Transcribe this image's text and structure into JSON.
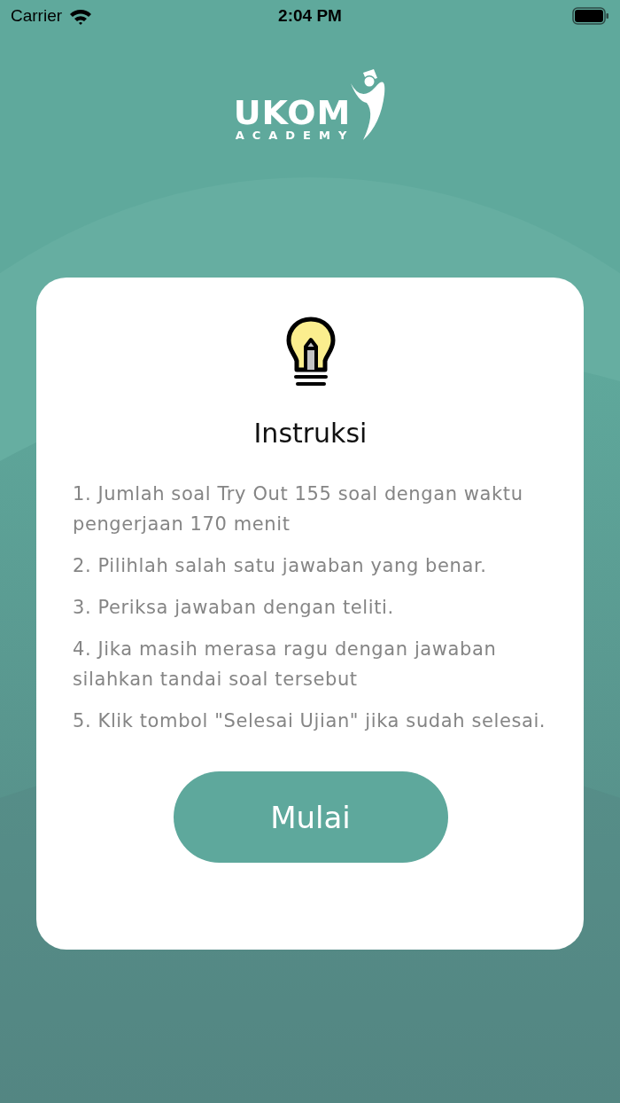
{
  "status_bar": {
    "carrier": "Carrier",
    "time": "2:04 PM"
  },
  "logo": {
    "title": "UKOM",
    "subtitle": "ACADEMY"
  },
  "card": {
    "title": "Instruksi",
    "instructions": [
      "1. Jumlah soal Try Out 155 soal dengan waktu pengerjaan 170 menit",
      "2. Pilihlah salah satu jawaban yang benar.",
      "3. Periksa jawaban dengan teliti.",
      "4. Jika masih merasa ragu dengan jawaban silahkan tandai soal tersebut",
      "5. Klik tombol \"Selesai Ujian\" jika sudah selesai."
    ],
    "button": "Mulai"
  }
}
